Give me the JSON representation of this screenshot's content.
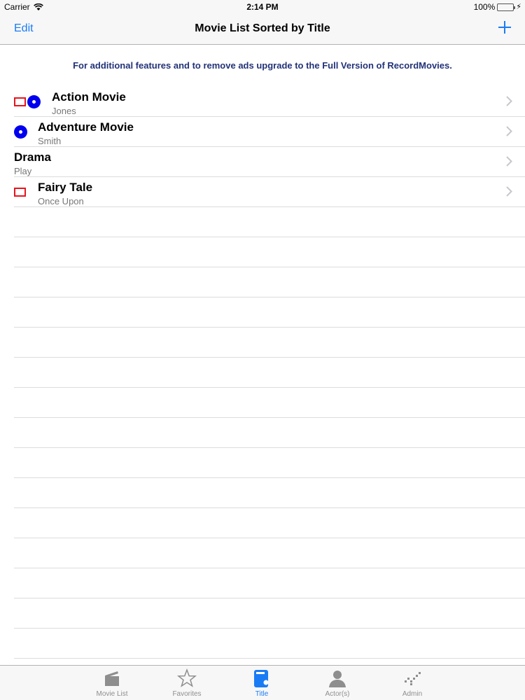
{
  "status_bar": {
    "carrier": "Carrier",
    "time": "2:14 PM",
    "battery": "100%"
  },
  "nav": {
    "edit_label": "Edit",
    "title": "Movie List Sorted by Title",
    "add_icon": "plus-icon"
  },
  "banner": "For additional features and to remove ads upgrade to the Full Version of RecordMovies.",
  "movies": [
    {
      "title": "Action Movie",
      "subtitle": "Jones",
      "icons": [
        "tape-icon",
        "disc-icon"
      ]
    },
    {
      "title": "Adventure Movie",
      "subtitle": "Smith",
      "icons": [
        "disc-icon"
      ]
    },
    {
      "title": "Drama",
      "subtitle": "Play",
      "icons": []
    },
    {
      "title": "Fairy Tale",
      "subtitle": "Once Upon",
      "icons": [
        "tape-icon"
      ]
    }
  ],
  "tabs": [
    {
      "label": "Movie List",
      "icon": "clapperboard-icon",
      "active": false
    },
    {
      "label": "Favorites",
      "icon": "star-icon",
      "active": false
    },
    {
      "label": "Title",
      "icon": "title-icon",
      "active": true
    },
    {
      "label": "Actor(s)",
      "icon": "person-icon",
      "active": false
    },
    {
      "label": "Admin",
      "icon": "admin-icon",
      "active": false
    }
  ],
  "colors": {
    "accent": "#1a7cf5",
    "tape": "#e8151c",
    "disc": "#0000ee",
    "banner_text": "#223377"
  }
}
